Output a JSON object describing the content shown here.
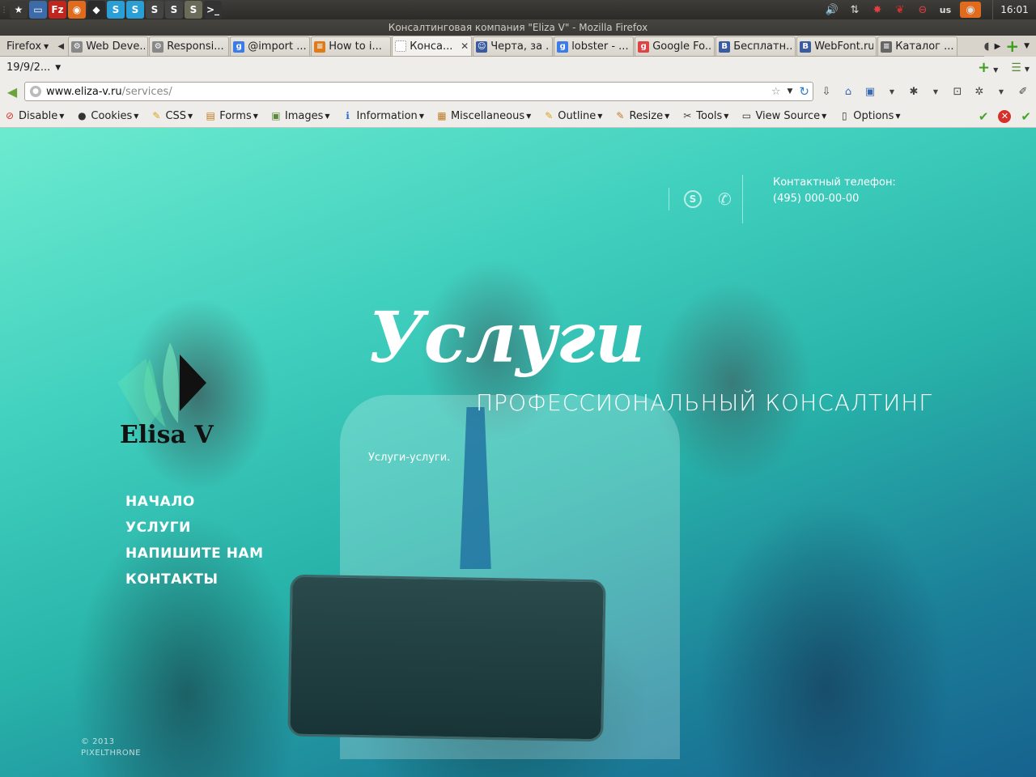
{
  "taskbar": {
    "launchers": [
      {
        "icon": "star-icon",
        "color": "#3a3935"
      },
      {
        "icon": "window-icon",
        "color": "#3d6aa8"
      },
      {
        "icon": "filezilla-icon",
        "color": "#c0261d",
        "glyph": "Fz"
      },
      {
        "icon": "firefox-icon",
        "color": "#e06a1e",
        "glyph": "◉"
      },
      {
        "icon": "inkscape-icon",
        "color": "#2b2b2b",
        "glyph": "◆"
      },
      {
        "icon": "skype-icon",
        "color": "#2a9fd6",
        "glyph": "S"
      },
      {
        "icon": "skype-icon",
        "color": "#2a9fd6",
        "glyph": "S"
      },
      {
        "icon": "s-logo-icon",
        "color": "#444",
        "glyph": "S"
      },
      {
        "icon": "s-logo-icon",
        "color": "#444",
        "glyph": "S"
      },
      {
        "icon": "sublime-icon",
        "color": "#6b6b5a",
        "glyph": "S"
      },
      {
        "icon": "terminal-icon",
        "color": "#333",
        "glyph": ">_"
      }
    ],
    "tray": {
      "volume": "volume-icon",
      "network": "network-icon",
      "lang": "us",
      "clock": "16:01"
    }
  },
  "window": {
    "title": "Консалтинговая компания \"Eliza V\" - Mozilla Firefox"
  },
  "tabs": {
    "menu_label": "Firefox",
    "items": [
      {
        "label": "Web Deve...",
        "fav_color": "#888",
        "fav": "⚙"
      },
      {
        "label": "Responsi...",
        "fav_color": "#888",
        "fav": "⚙"
      },
      {
        "label": "@import ...",
        "fav_color": "#3b7ce6",
        "fav": "g"
      },
      {
        "label": "How to i...",
        "fav_color": "#e07b1a",
        "fav": "≡"
      },
      {
        "label": "Конса...",
        "fav_color": "#bbb",
        "fav": "",
        "active": true
      },
      {
        "label": "Черта, за ...",
        "fav_color": "#3b5ba0",
        "fav": "☺"
      },
      {
        "label": "lobster - ...",
        "fav_color": "#3b7ce6",
        "fav": "g"
      },
      {
        "label": "Google Fo...",
        "fav_color": "#d44",
        "fav": "g"
      },
      {
        "label": "Бесплатн...",
        "fav_color": "#3b5ba0",
        "fav": "B"
      },
      {
        "label": "WebFont.ru",
        "fav_color": "#3b5ba0",
        "fav": "B"
      },
      {
        "label": "Каталог ...",
        "fav_color": "#666",
        "fav": "≡"
      }
    ]
  },
  "session": {
    "label": "19/9/2..."
  },
  "nav": {
    "url_domain": "www.eliza-v.ru",
    "url_path": "/services/"
  },
  "webdev": {
    "items": [
      {
        "label": "Disable",
        "icon": "disable-icon",
        "glyph": "⊘",
        "color": "#d6302b"
      },
      {
        "label": "Cookies",
        "icon": "cookie-icon",
        "glyph": "●",
        "color": "#333"
      },
      {
        "label": "CSS",
        "icon": "pencil-icon",
        "glyph": "✎",
        "color": "#d8a21a"
      },
      {
        "label": "Forms",
        "icon": "form-icon",
        "glyph": "▤",
        "color": "#c07a20"
      },
      {
        "label": "Images",
        "icon": "image-icon",
        "glyph": "▣",
        "color": "#5a8a3a"
      },
      {
        "label": "Information",
        "icon": "info-icon",
        "glyph": "ℹ",
        "color": "#2a6fd6"
      },
      {
        "label": "Miscellaneous",
        "icon": "misc-icon",
        "glyph": "▦",
        "color": "#c07a20"
      },
      {
        "label": "Outline",
        "icon": "outline-icon",
        "glyph": "✎",
        "color": "#d8a21a"
      },
      {
        "label": "Resize",
        "icon": "resize-icon",
        "glyph": "✎",
        "color": "#c07a20"
      },
      {
        "label": "Tools",
        "icon": "tools-icon",
        "glyph": "✂",
        "color": "#444"
      },
      {
        "label": "View Source",
        "icon": "source-icon",
        "glyph": "▭",
        "color": "#333"
      },
      {
        "label": "Options",
        "icon": "options-icon",
        "glyph": "▯",
        "color": "#333"
      }
    ]
  },
  "page": {
    "contact_label": "Контактный телефон:",
    "contact_phone": "(495) 000-00-00",
    "hero_title": "Услуги",
    "hero_subtitle": "ПРОФЕССИОНАЛЬНЫЙ КОНСАЛТИНГ",
    "hero_body": "Услуги-услуги.",
    "logo_name": "Elisa V",
    "menu": [
      "НАЧАЛО",
      "УСЛУГИ",
      "НАПИШИТЕ НАМ",
      "КОНТАКТЫ"
    ],
    "copyright_line1": "© 2013",
    "copyright_line2": "PIXELTHRONE"
  }
}
